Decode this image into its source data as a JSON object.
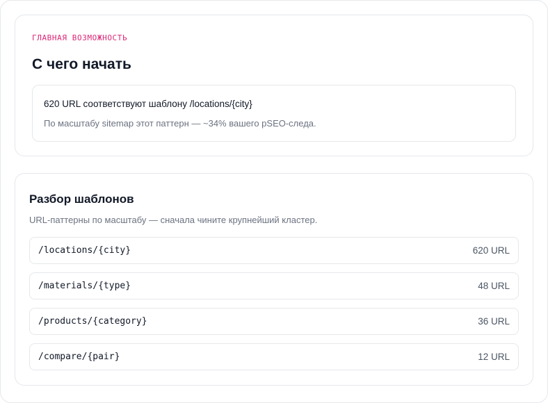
{
  "feature": {
    "eyebrow": "ГЛАВНАЯ ВОЗМОЖНОСТЬ",
    "title": "С чего начать",
    "insight_main": "620 URL соответствуют шаблону /locations/{city}",
    "insight_sub": "По масштабу sitemap этот паттерн — ~34% вашего pSEO-следа."
  },
  "breakdown": {
    "title": "Разбор шаблонов",
    "subtitle": "URL-паттерны по масштабу — сначала чините крупнейший кластер.",
    "rows": [
      {
        "path": "/locations/{city}",
        "count": "620 URL"
      },
      {
        "path": "/materials/{type}",
        "count": "48 URL"
      },
      {
        "path": "/products/{category}",
        "count": "36 URL"
      },
      {
        "path": "/compare/{pair}",
        "count": "12 URL"
      }
    ]
  },
  "colors": {
    "eyebrow_accent": "#db2777",
    "border": "#e5e7eb",
    "muted_text": "#6b7280"
  }
}
